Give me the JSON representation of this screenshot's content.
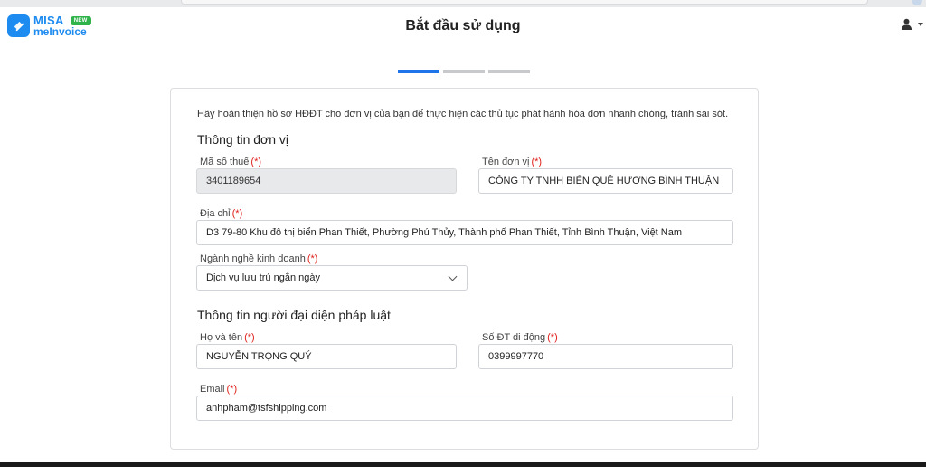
{
  "brand": {
    "name_line1": "MISA",
    "name_line2": "meInvoice",
    "tag": "NEW",
    "accent_color": "#1e8bf0"
  },
  "header": {
    "title": "Bắt đầu sử dụng",
    "user_icon": "user-icon",
    "menu_icon": "caret-down-icon"
  },
  "stepper": {
    "total_steps": 3,
    "current_step": 1
  },
  "form": {
    "intro": "Hãy hoàn thiện hồ sơ HĐĐT cho đơn vị của bạn để thực hiện các thủ tục phát hành hóa đơn nhanh chóng, tránh sai sót.",
    "required_mark": "(*)",
    "unit_section": {
      "title": "Thông tin đơn vị",
      "tax_code": {
        "label": "Mã số thuế",
        "value": "3401189654"
      },
      "unit_name": {
        "label": "Tên đơn vị",
        "value": "CÔNG TY TNHH BIỂN QUÊ HƯƠNG BÌNH THUẬN"
      },
      "address": {
        "label": "Địa chỉ",
        "value": "D3 79-80 Khu đô thị biển Phan Thiết, Phường Phú Thủy, Thành phố Phan Thiết, Tỉnh Bình Thuận, Việt Nam"
      },
      "business_line": {
        "label": "Ngành nghề kinh doanh",
        "value": "Dịch vụ lưu trú ngắn ngày"
      }
    },
    "rep_section": {
      "title": "Thông tin người đại diện pháp luật",
      "full_name": {
        "label": "Họ và tên",
        "value": "NGUYỄN TRỌNG QUÝ"
      },
      "mobile": {
        "label": "Số ĐT di động",
        "value": "0399997770"
      },
      "email": {
        "label": "Email",
        "value": "anhpham@tsfshipping.com"
      }
    }
  }
}
